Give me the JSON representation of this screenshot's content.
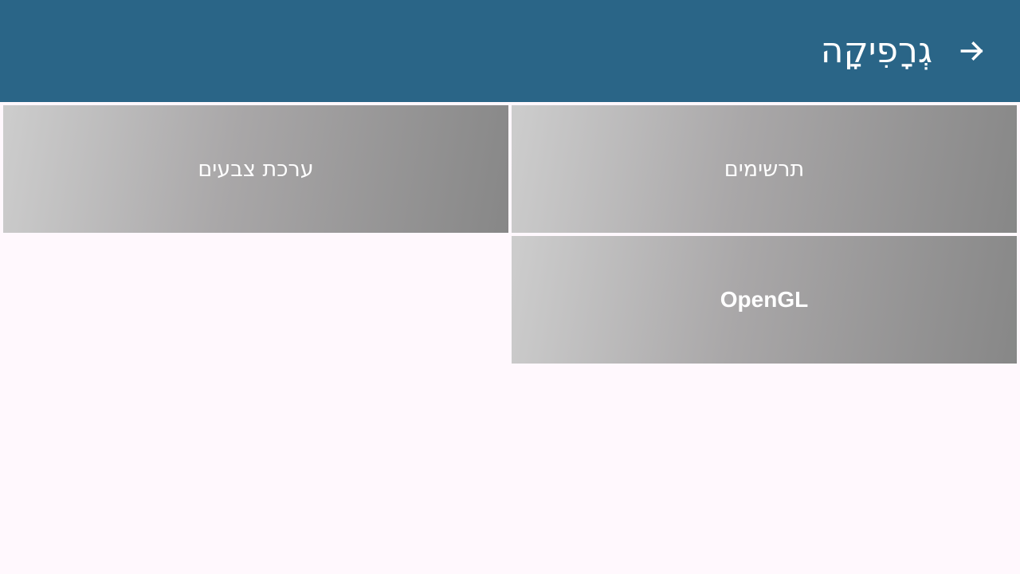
{
  "toolbar": {
    "title": "גְרָפִיקָה",
    "back_icon": "arrow-right-icon"
  },
  "tiles": [
    {
      "label": "תרשימים"
    },
    {
      "label": "ערכת צבעים"
    },
    {
      "label": "OpenGL"
    }
  ],
  "colors": {
    "toolbar": "#2a6587",
    "background": "#fff8fd",
    "tile_gradient_start": "#cdcdcd",
    "tile_gradient_end": "#878787",
    "text_on_dark": "#ffffff"
  }
}
